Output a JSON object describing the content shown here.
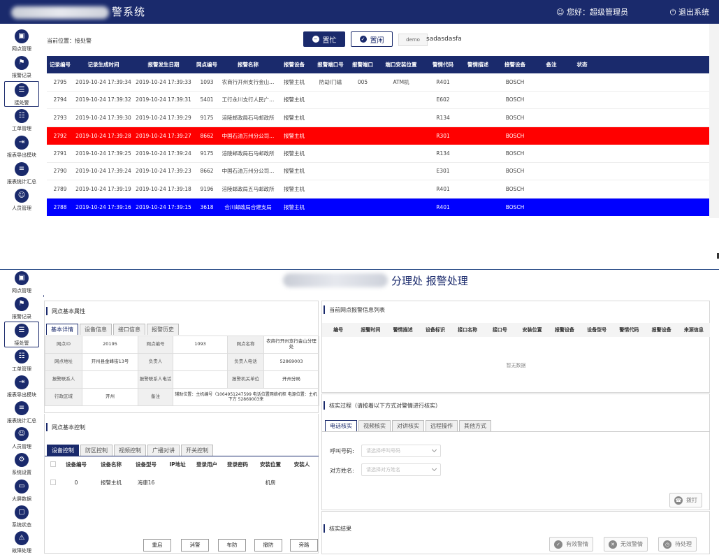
{
  "header": {
    "title_suffix": "警系统",
    "user": "您好：超级管理员",
    "logout": "退出系统"
  },
  "sidebar1": [
    {
      "label": "网点管理",
      "icon": "map-icon"
    },
    {
      "label": "报警记录",
      "icon": "alarm-icon"
    },
    {
      "label": "接处警",
      "icon": "list-icon",
      "active": true
    },
    {
      "label": "工单管理",
      "icon": "clipboard-icon"
    },
    {
      "label": "报表导出模块",
      "icon": "export-icon"
    },
    {
      "label": "报表统计汇总",
      "icon": "chart-icon"
    },
    {
      "label": "人员管理",
      "icon": "person-icon"
    }
  ],
  "top": {
    "breadcrumb": "当前位置：接处警",
    "busy": "置忙",
    "free": "置闲",
    "demo": "demo",
    "username": "sadasdasfa"
  },
  "alarm_table": {
    "headers": [
      "记录编号",
      "记录生成时间",
      "报警发生日期",
      "网点编号",
      "报警名称",
      "报警设备",
      "报警端口号",
      "报警端口",
      "端口安装位置",
      "警情代码",
      "警情描述",
      "接警设备",
      "备注",
      "状态"
    ],
    "rows": [
      [
        "2795",
        "2019-10-24 17:39:34",
        "2019-10-24 17:39:33",
        "1093",
        "农商行开州支行金山...",
        "报警主机",
        "防劫/门磁",
        "005",
        "ATM机",
        "R401",
        "",
        "BOSCH",
        "",
        ""
      ],
      [
        "2794",
        "2019-10-24 17:39:32",
        "2019-10-24 17:39:31",
        "5401",
        "工行永川支行人民广...",
        "报警主机",
        "",
        "",
        "",
        "E602",
        "",
        "BOSCH",
        "",
        ""
      ],
      [
        "2793",
        "2019-10-24 17:39:30",
        "2019-10-24 17:39:29",
        "9175",
        "涪陵邮政局石马邮政所",
        "报警主机",
        "",
        "",
        "",
        "R134",
        "",
        "BOSCH",
        "",
        ""
      ],
      [
        "2792",
        "2019-10-24 17:39:28",
        "2019-10-24 17:39:27",
        "8662",
        "中国石油万州分公司...",
        "报警主机",
        "",
        "",
        "",
        "R301",
        "",
        "BOSCH",
        "",
        ""
      ],
      [
        "2791",
        "2019-10-24 17:39:25",
        "2019-10-24 17:39:24",
        "9175",
        "涪陵邮政局石马邮政所",
        "报警主机",
        "",
        "",
        "",
        "R134",
        "",
        "BOSCH",
        "",
        ""
      ],
      [
        "2790",
        "2019-10-24 17:39:24",
        "2019-10-24 17:39:23",
        "8662",
        "中国石油万州分公司...",
        "报警主机",
        "",
        "",
        "",
        "E301",
        "",
        "BOSCH",
        "",
        ""
      ],
      [
        "2789",
        "2019-10-24 17:39:19",
        "2019-10-24 17:39:18",
        "9196",
        "涪陵邮政局五马邮政所",
        "报警主机",
        "",
        "",
        "",
        "R401",
        "",
        "BOSCH",
        "",
        ""
      ],
      [
        "2788",
        "2019-10-24 17:39:16",
        "2019-10-24 17:39:15",
        "3618",
        "合川邮政局合建支局",
        "报警主机",
        "",
        "",
        "",
        "R401",
        "",
        "BOSCH",
        "",
        ""
      ]
    ],
    "row_status": [
      "normal",
      "normal",
      "normal",
      "red",
      "normal",
      "normal",
      "normal",
      "blue"
    ]
  },
  "page2": {
    "title_suffix": "分理处  报警处理",
    "sidebar": [
      {
        "label": "网点管理",
        "icon": "map-icon"
      },
      {
        "label": "报警记录",
        "icon": "alarm-icon"
      },
      {
        "label": "接处警",
        "icon": "list-icon",
        "active": true
      },
      {
        "label": "工单管理",
        "icon": "clipboard-icon"
      },
      {
        "label": "报表导出模块",
        "icon": "export-icon"
      },
      {
        "label": "报表统计汇总",
        "icon": "chart-icon"
      },
      {
        "label": "人员管理",
        "icon": "person-icon"
      },
      {
        "label": "系统设置",
        "icon": "gear-icon"
      },
      {
        "label": "大屏数据",
        "icon": "screen-icon"
      },
      {
        "label": "系统状态",
        "icon": "monitor-icon"
      },
      {
        "label": "故障处理",
        "icon": "warning-icon"
      }
    ],
    "basic": {
      "title": "网点基本属性",
      "tabs": [
        "基本详情",
        "设备信息",
        "接口信息",
        "报警历史"
      ],
      "cells": [
        [
          "网点ID",
          "20195",
          "网点编号",
          "1093",
          "网点名称",
          "农商行开州支行金山分理处"
        ],
        [
          "网点地址",
          "开州县金峰街13号",
          "负责人",
          "",
          "负责人电话",
          "52869003"
        ],
        [
          "报警联系人",
          "",
          "报警联系人电话",
          "",
          "报警机关单位",
          "开州分局"
        ],
        [
          "行政区域",
          "开州",
          "备注",
          "辅助位置：主机编号（1064951247599 电话位置网络机柜 电源位置：主机下方 52869003来",
          "",
          ""
        ]
      ]
    },
    "control": {
      "title": "网点基本控制",
      "tabs": [
        "设备控制",
        "防区控制",
        "视频控制",
        "广播对讲",
        "开关控制"
      ],
      "headers": [
        "",
        "设备编号",
        "设备名称",
        "设备型号",
        "IP地址",
        "登录用户",
        "登录密码",
        "安装位置",
        "安装人"
      ],
      "row": [
        "",
        "0",
        "报警主机",
        "海康16",
        "",
        "",
        "",
        "机房",
        ""
      ],
      "buttons": [
        "重启",
        "消警",
        "布防",
        "撤防",
        "旁路"
      ]
    },
    "alarm_list": {
      "title": "当前网点报警信息列表",
      "headers": [
        "编号",
        "报警时间",
        "警情描述",
        "设备标识",
        "接口名称",
        "接口号",
        "安装位置",
        "报警设备",
        "设备型号",
        "警情代码",
        "报警设备",
        "来源信息"
      ],
      "empty": "暂无数据"
    },
    "verify": {
      "title": "核实过程（请按着以下方式对警情进行核实）",
      "tabs": [
        "电话核实",
        "视频核实",
        "对讲核实",
        "远程操作",
        "其他方式"
      ],
      "call_label": "呼叫号码:",
      "call_placeholder": "请选择呼叫号码",
      "name_label": "对方姓名:",
      "name_placeholder": "请选择对方姓名",
      "dial": "拨打"
    },
    "result": {
      "title": "核实结果",
      "buttons": [
        "有效警情",
        "无效警情",
        "待处理"
      ]
    }
  }
}
